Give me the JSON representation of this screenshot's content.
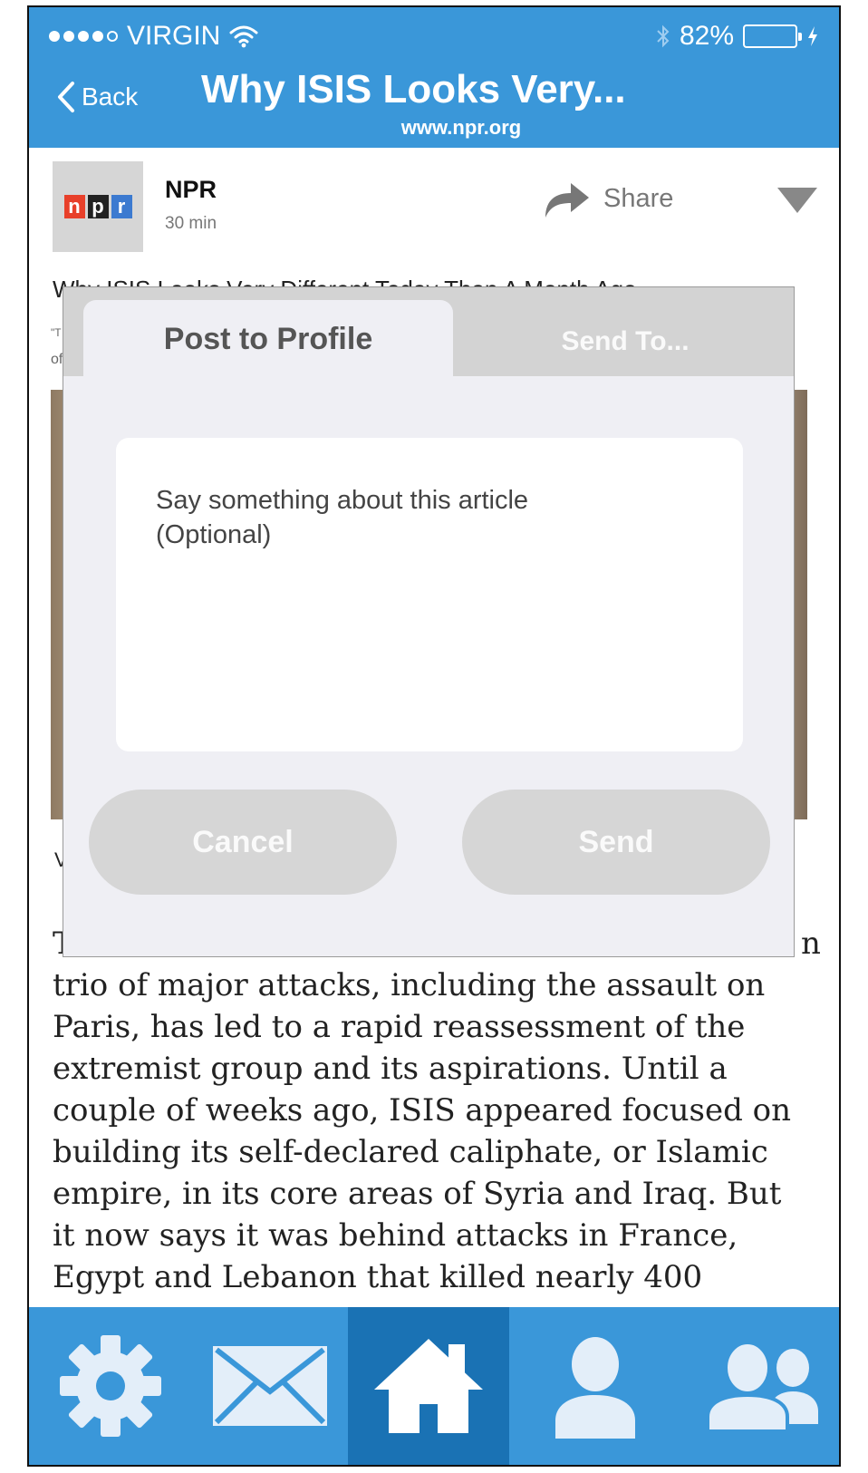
{
  "status_bar": {
    "carrier": "VIRGIN",
    "battery_percent": "82%",
    "battery_level": 0.82,
    "signal_bars_filled": 4,
    "signal_bars_total": 5
  },
  "nav": {
    "back_label": "Back",
    "title": "Why ISIS Looks Very...",
    "url": "www.npr.org"
  },
  "post": {
    "logo_letters": [
      "n",
      "p",
      "r"
    ],
    "logo_colors": [
      "#e8402a",
      "#222222",
      "#3c7ad0"
    ],
    "source": "NPR",
    "time": "30 min",
    "share_label": "Share"
  },
  "article": {
    "headline": "Why ISIS Looks Very Different Today Than A Month Ago",
    "sub_line_1": "\"T",
    "sub_line_2": "of",
    "side_letter": "V",
    "body_lines": [
      "T",
      "trio of major attacks, including the assault on",
      "Paris, has led to a rapid reassessment of the",
      "extremist group and its aspirations. Until a",
      "couple of weeks ago, ISIS appeared focused on",
      "building its self-declared caliphate, or Islamic",
      "empire, in its core areas of Syria and Iraq. But",
      "it now says it was behind attacks in France,",
      "Egypt and Lebanon that killed nearly 400"
    ],
    "body_edge_letter": "n"
  },
  "modal": {
    "tab_active": "Post to Profile",
    "tab_inactive": "Send To...",
    "comment_placeholder": "Say something about this article\n(Optional)",
    "cancel_label": "Cancel",
    "send_label": "Send"
  },
  "tabbar": {
    "items": [
      "settings",
      "messages",
      "home",
      "profile",
      "friends"
    ],
    "active": "home"
  },
  "colors": {
    "brand_blue": "#3a97d9",
    "active_tab_blue": "#1a72b4",
    "icon_light": "#e3eef9"
  }
}
